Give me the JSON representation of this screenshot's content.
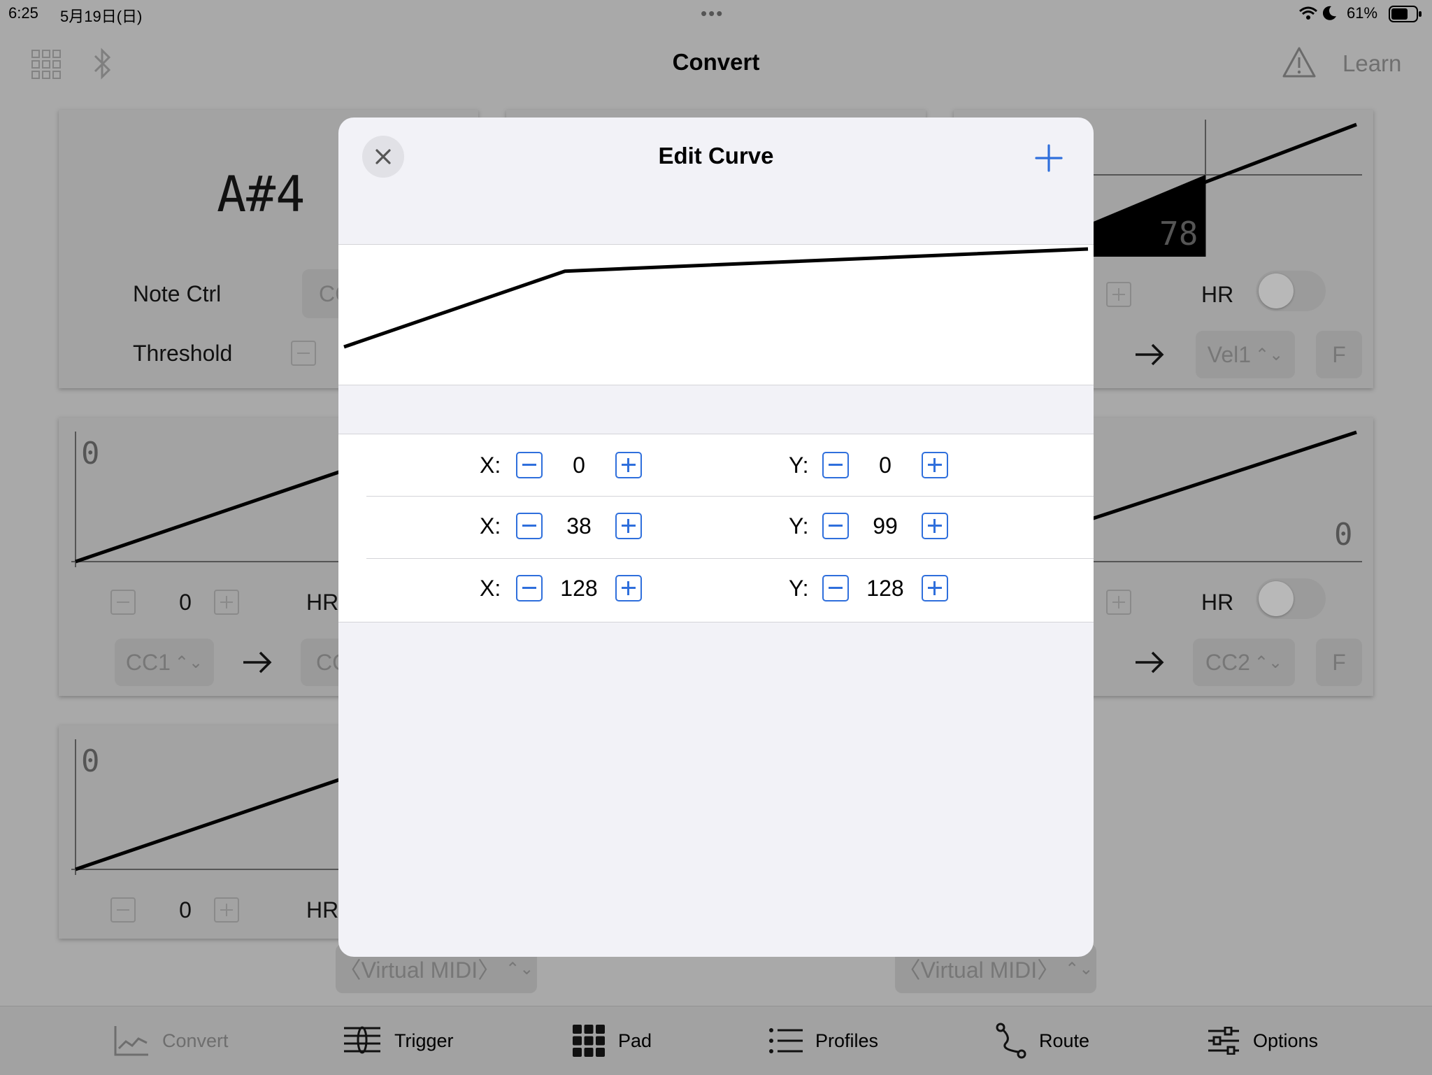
{
  "status": {
    "time": "6:25",
    "date": "5月19日(日)",
    "battery": "61%"
  },
  "nav": {
    "title": "Convert",
    "learn": "Learn"
  },
  "background": {
    "note": "A#4",
    "note_ctrl": "Note Ctrl",
    "note_ctrl_value": "CC",
    "threshold": "Threshold",
    "value_78": "78",
    "hr": "HR",
    "vel1": "Vel1",
    "f": "F",
    "zero": "0",
    "cc1": "CC1",
    "cc_short": "CC",
    "cc2": "CC2",
    "virtual_midi": "〈Virtual MIDI〉"
  },
  "modal": {
    "title": "Edit Curve",
    "rows": [
      {
        "x_label": "X:",
        "x": "0",
        "y_label": "Y:",
        "y": "0"
      },
      {
        "x_label": "X:",
        "x": "38",
        "y_label": "Y:",
        "y": "99"
      },
      {
        "x_label": "X:",
        "x": "128",
        "y_label": "Y:",
        "y": "128"
      }
    ]
  },
  "curve_points": [
    [
      0,
      0
    ],
    [
      38,
      99
    ],
    [
      128,
      128
    ]
  ],
  "tabs": [
    "Convert",
    "Trigger",
    "Pad",
    "Profiles",
    "Route",
    "Options"
  ],
  "colors": {
    "accent": "#2f6fdc",
    "dim_bg": "#a9a9a9"
  }
}
